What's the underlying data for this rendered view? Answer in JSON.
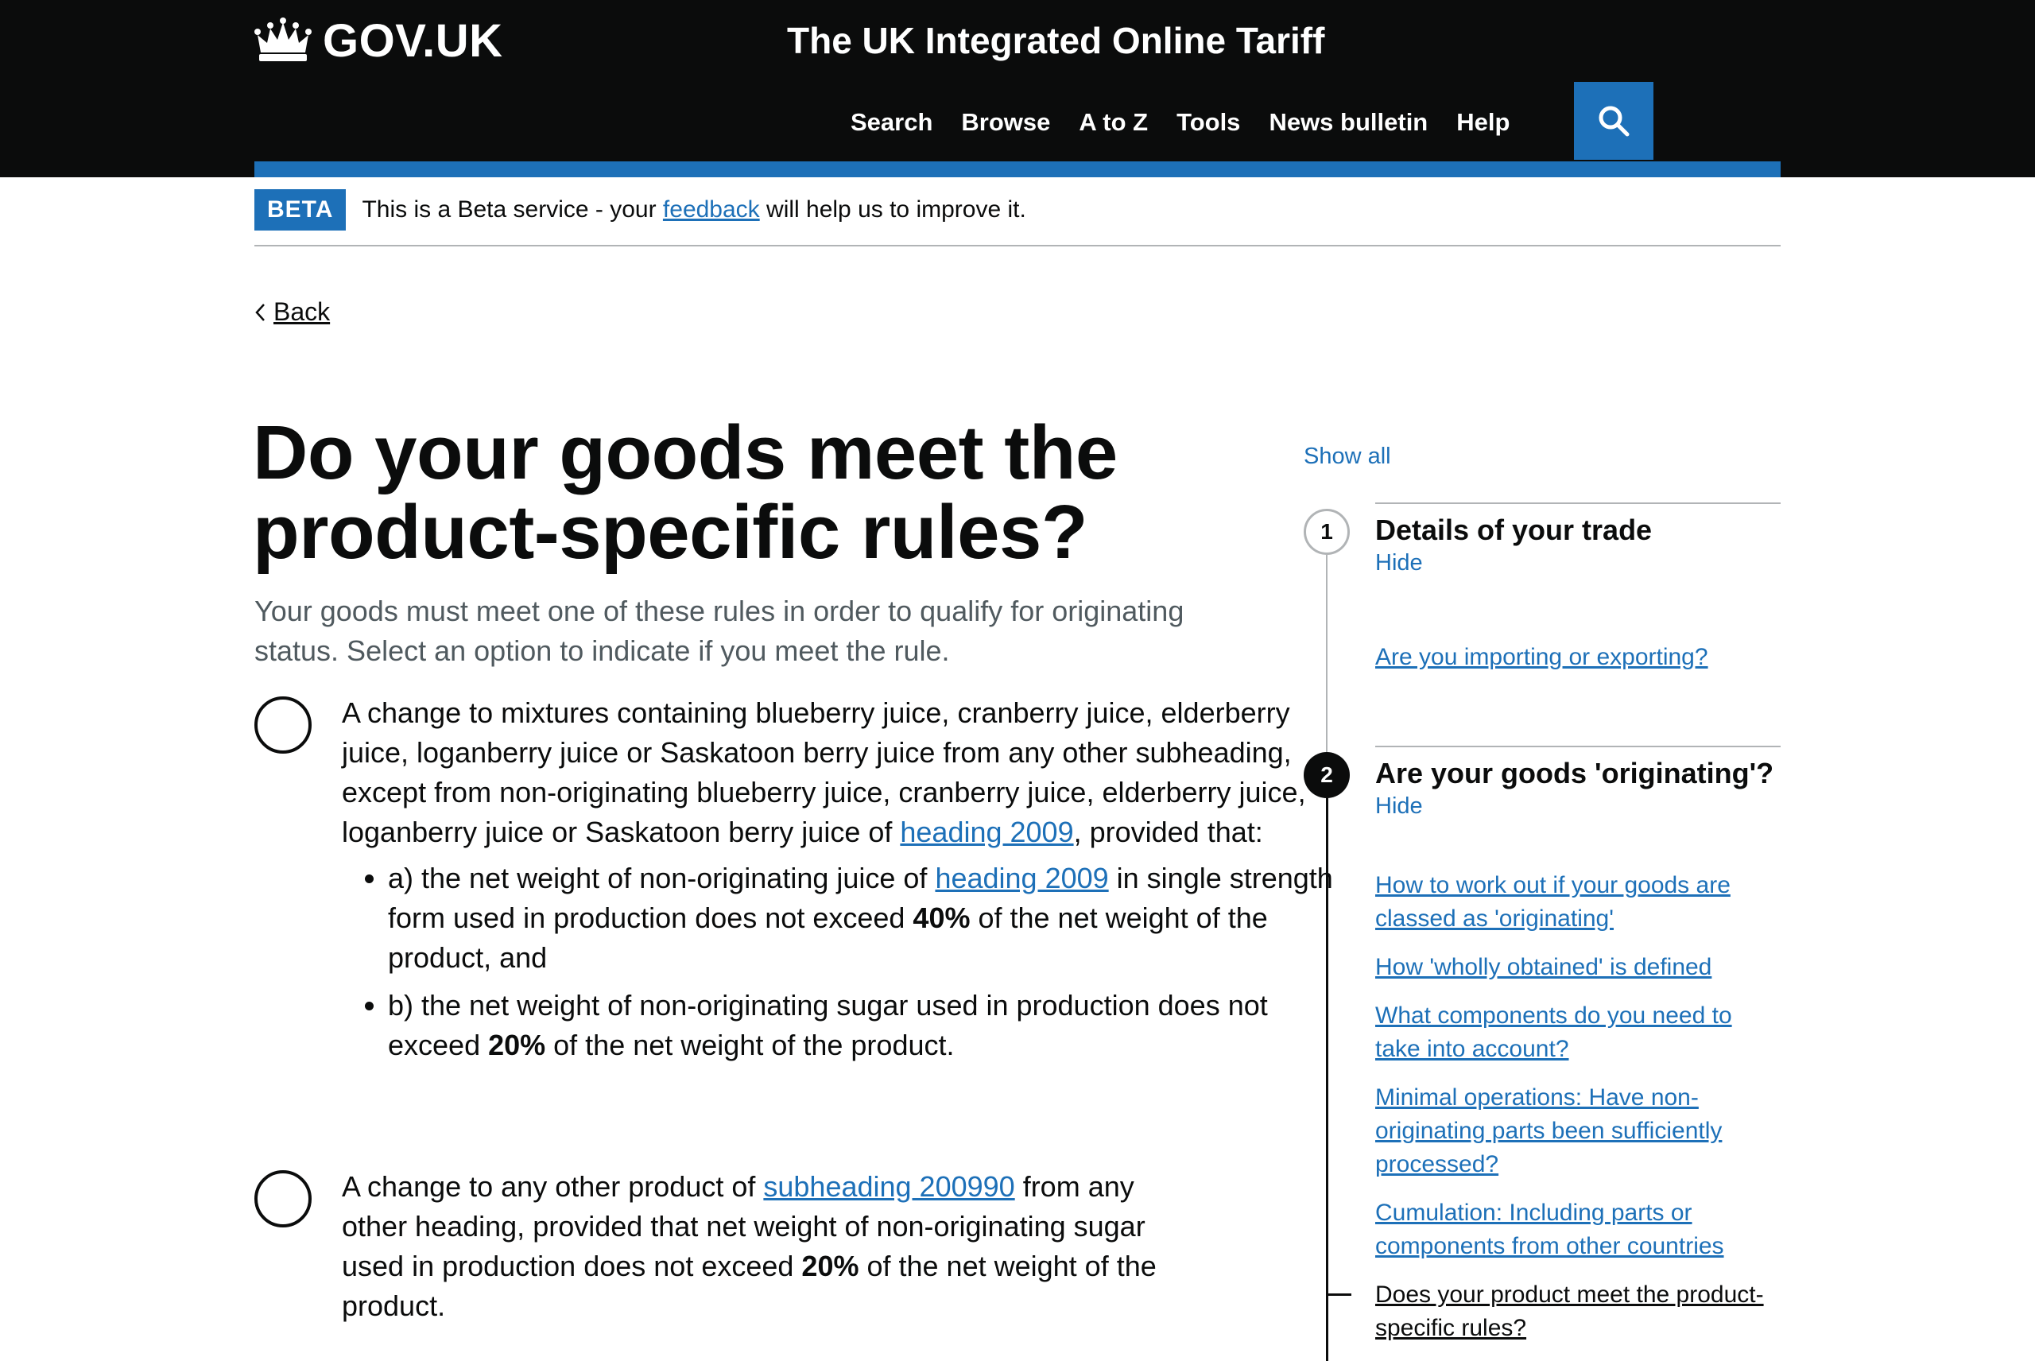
{
  "header": {
    "logo_text": "GOV.UK",
    "service_name": "The UK Integrated Online Tariff",
    "nav": [
      "Search",
      "Browse",
      "A to Z",
      "Tools",
      "News bulletin",
      "Help"
    ]
  },
  "beta": {
    "tag": "BETA",
    "text_before": "This is a Beta service - your ",
    "link": "feedback",
    "text_after": " will help us to improve it."
  },
  "back_label": "Back",
  "title": "Do your goods meet the product-specific rules?",
  "lead": "Your goods must meet one of these rules in order to qualify for originating status. Select an option to indicate if you meet the rule.",
  "options": [
    {
      "intro": "A change to mixtures containing blueberry juice, cranberry juice, elderberry juice, loganberry juice or Saskatoon berry juice from any other subheading, except from non-originating blueberry juice, cranberry juice, elderberry juice, loganberry juice or Saskatoon berry juice of ",
      "intro_link": "heading 2009",
      "intro_end": ", provided that:",
      "bullets": [
        {
          "a1": "a) the net weight of non-originating juice of ",
          "link": "heading 2009",
          "a2": " in single strength form used in production does not exceed ",
          "pct": "40%",
          "a3": " of the net weight of the product, and"
        },
        {
          "b1": "b) the net weight of non-originating sugar used in production does not exceed ",
          "pct": "20%",
          "b2": " of the net weight of the product."
        }
      ]
    },
    {
      "t1": "A change to any other product of ",
      "link": "subheading 200990",
      "t2": " from any other heading, provided that net weight of non-originating sugar used in production does not exceed ",
      "pct": "20%",
      "t3": " of the net weight of the product."
    }
  ],
  "sidebar": {
    "show_all": "Show all",
    "steps": [
      {
        "number": "1",
        "title": "Details of your trade",
        "hide": "Hide",
        "links": [
          "Are you importing or exporting?"
        ]
      },
      {
        "number": "2",
        "title": "Are your goods 'originating'?",
        "hide": "Hide",
        "links": [
          "How to work out if your goods are classed as 'originating'",
          "How 'wholly obtained' is defined",
          "What components do you need to take into account?",
          "Minimal operations: Have non-originating parts been sufficiently processed?",
          "Cumulation: Including parts or components from other countries",
          "Does your product meet the product-specific rules?"
        ]
      }
    ]
  },
  "colors": {
    "header_bg": "#0b0c0c",
    "brand_blue": "#1d70b8",
    "link": "#1d70b8",
    "border": "#b1b4b6"
  }
}
